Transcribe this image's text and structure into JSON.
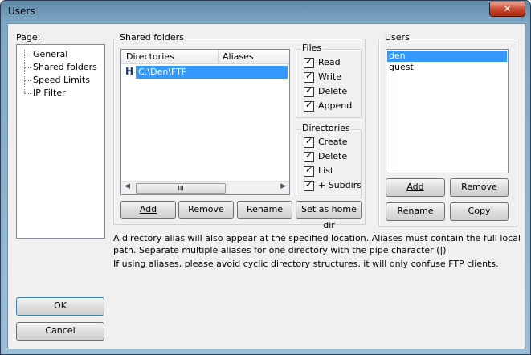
{
  "window": {
    "title": "Users",
    "close_glyph": "✕"
  },
  "page_panel": {
    "label": "Page:",
    "items": [
      "General",
      "Shared folders",
      "Speed Limits",
      "IP Filter"
    ]
  },
  "shared_folders": {
    "group_title": "Shared folders",
    "columns": [
      "Directories",
      "Aliases"
    ],
    "rows": [
      {
        "flag": "H",
        "path": "C:\\Den\\FTP"
      }
    ],
    "scroll_grip": "III",
    "buttons": {
      "add": "Add",
      "remove": "Remove",
      "rename": "Rename",
      "set_home": "Set as home dir"
    }
  },
  "files": {
    "group_title": "Files",
    "options": [
      {
        "label": "Read",
        "checked": true
      },
      {
        "label": "Write",
        "checked": true
      },
      {
        "label": "Delete",
        "checked": true
      },
      {
        "label": "Append",
        "checked": true
      }
    ]
  },
  "directories": {
    "group_title": "Directories",
    "options": [
      {
        "label": "Create",
        "checked": true
      },
      {
        "label": "Delete",
        "checked": true
      },
      {
        "label": "List",
        "checked": true
      },
      {
        "label": "+ Subdirs",
        "checked": true
      }
    ]
  },
  "users": {
    "group_title": "Users",
    "list": [
      "den",
      "guest"
    ],
    "selected": "den",
    "buttons": {
      "add": "Add",
      "remove": "Remove",
      "rename": "Rename",
      "copy": "Copy"
    }
  },
  "notes": {
    "line1": "A directory alias will also appear at the specified location. Aliases must contain the full local",
    "line2": "path. Separate multiple aliases for one directory with the pipe character (|)",
    "line3": "If using aliases, please avoid cyclic directory structures, it will only confuse FTP clients."
  },
  "dialog_buttons": {
    "ok": "OK",
    "cancel": "Cancel"
  },
  "colors": {
    "selection": "#3399ff",
    "title_bar": "#7fa8c6"
  }
}
